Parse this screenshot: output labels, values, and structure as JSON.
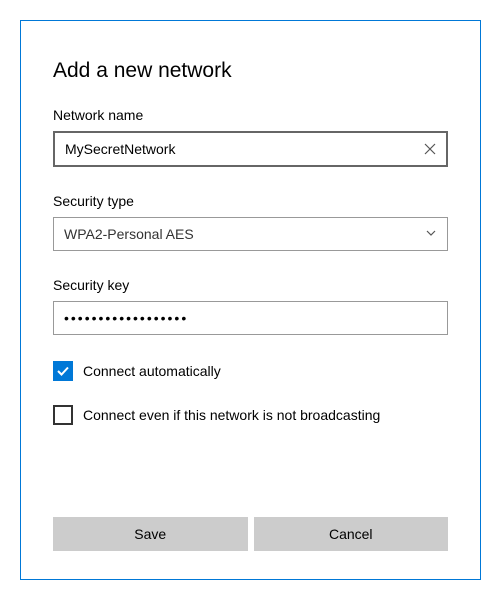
{
  "title": "Add a new network",
  "networkName": {
    "label": "Network name",
    "value": "MySecretNetwork"
  },
  "securityType": {
    "label": "Security type",
    "selected": "WPA2-Personal AES"
  },
  "securityKey": {
    "label": "Security key",
    "masked": "••••••••••••••••••"
  },
  "connectAuto": {
    "label": "Connect automatically",
    "checked": true
  },
  "connectHidden": {
    "label": "Connect even if this network is not broadcasting",
    "checked": false
  },
  "buttons": {
    "save": "Save",
    "cancel": "Cancel"
  }
}
